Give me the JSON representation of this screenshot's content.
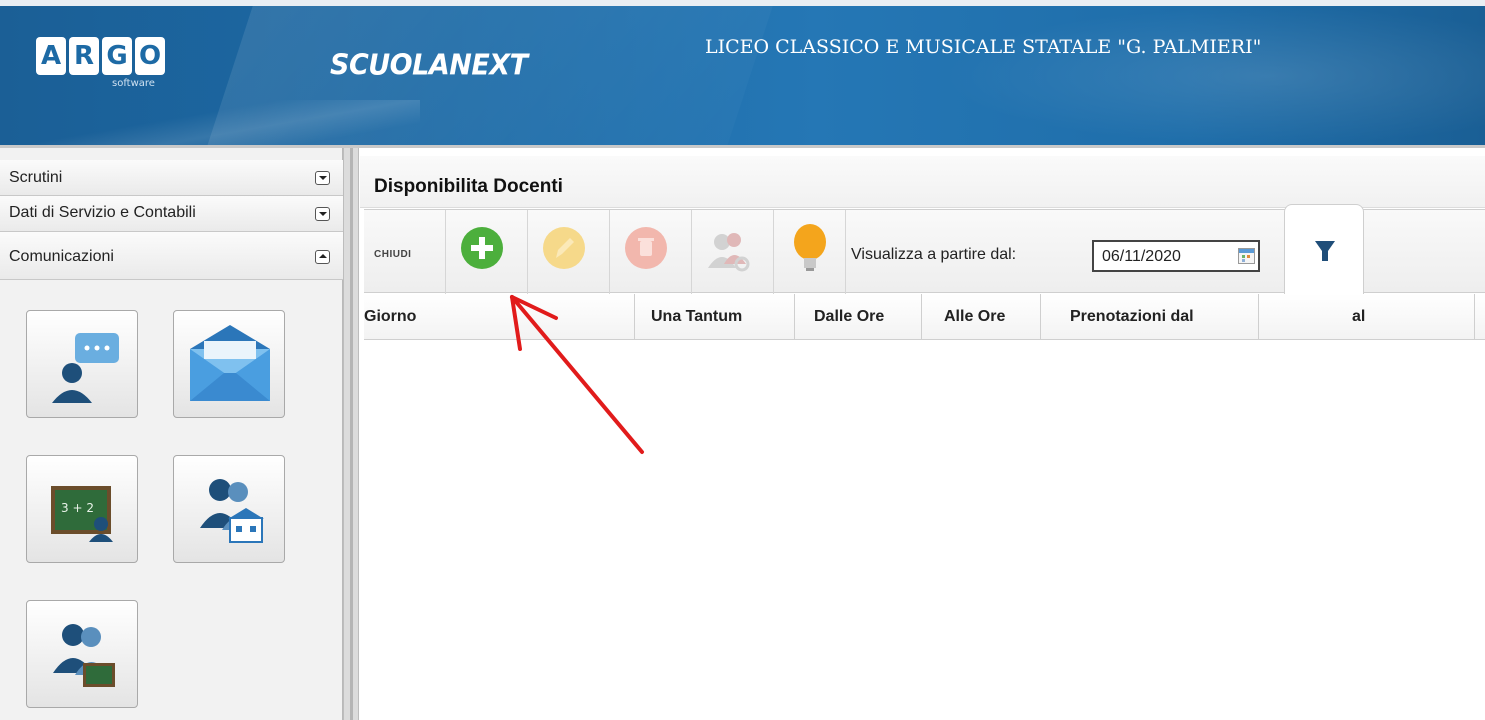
{
  "header": {
    "logo_letters": [
      "A",
      "R",
      "G",
      "O"
    ],
    "logo_sub": "software",
    "brand": "SCUOLANEXT",
    "school_name": "LICEO CLASSICO E MUSICALE STATALE \"G. PALMIERI\""
  },
  "sidebar": {
    "menus": [
      {
        "label": "Scrutini",
        "state": "collapsed"
      },
      {
        "label": "Dati di Servizio e Contabili",
        "state": "collapsed"
      },
      {
        "label": "Comunicazioni",
        "state": "expanded"
      }
    ],
    "tiles": [
      {
        "icon": "chat-person-icon"
      },
      {
        "icon": "envelope-icon"
      },
      {
        "icon": "blackboard-teacher-icon"
      },
      {
        "icon": "people-school-icon"
      },
      {
        "icon": "people-blackboard-icon"
      }
    ]
  },
  "main": {
    "title": "Disponibilita Docenti",
    "toolbar": {
      "close_label": "CHIUDI",
      "date_label": "Visualizza a partire dal:",
      "date_value": "06/11/2020",
      "buttons": [
        {
          "icon": "add-icon",
          "enabled": true,
          "color": "#4caf3c"
        },
        {
          "icon": "edit-icon",
          "enabled": false,
          "color": "#f6d98a"
        },
        {
          "icon": "delete-icon",
          "enabled": false,
          "color": "#f2b7ad"
        },
        {
          "icon": "users-key-icon",
          "enabled": false,
          "color": "#cfcfcf"
        },
        {
          "icon": "lightbulb-icon",
          "enabled": true,
          "color": "#f4a51c"
        }
      ]
    },
    "table": {
      "columns": [
        "Giorno",
        "Una Tantum",
        "Dalle Ore",
        "Alle Ore",
        "Prenotazioni dal",
        "al"
      ],
      "rows": []
    }
  },
  "annotation": {
    "arrow_color": "#e11b1b"
  }
}
